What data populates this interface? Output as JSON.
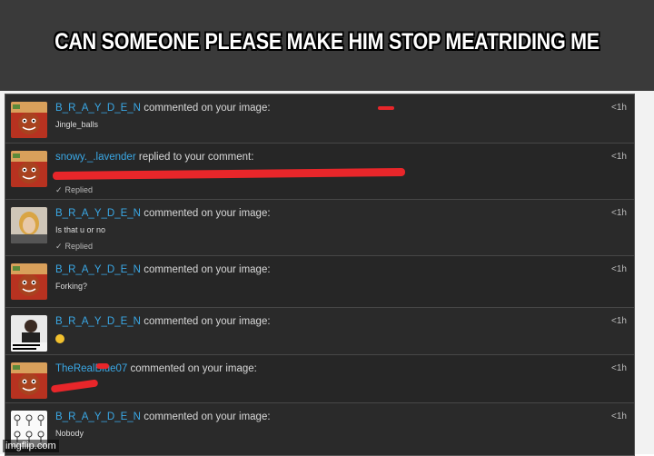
{
  "caption": "CAN SOMEONE PLEASE MAKE HIM STOP MEATRIDING ME",
  "watermark": "imgflip.com",
  "notifications": [
    {
      "user": "B_R_A_Y_D_E_N",
      "action": "commented on your image:",
      "time": "<1h",
      "text": "Jingle_balls",
      "sub": "",
      "avatar": "gingerbread-icon"
    },
    {
      "user": "snowy._.lavender",
      "action": "replied to your comment:",
      "time": "<1h",
      "text": "",
      "sub": "Replied",
      "avatar": "gingerbread-icon"
    },
    {
      "user": "B_R_A_Y_D_E_N",
      "action": "commented on your image:",
      "time": "<1h",
      "text": "Is that u or no",
      "sub": "Replied",
      "avatar": "photo-thumbnail-icon"
    },
    {
      "user": "B_R_A_Y_D_E_N",
      "action": "commented on your image:",
      "time": "<1h",
      "text": "Forking?",
      "sub": "",
      "avatar": "gingerbread-icon"
    },
    {
      "user": "B_R_A_Y_D_E_N",
      "action": "commented on your image:",
      "time": "<1h",
      "text": "",
      "sub": "",
      "avatar": "photo-thumbnail-icon"
    },
    {
      "user": "TheRealBlue07",
      "action": "commented on your image:",
      "time": "<1h",
      "text": "",
      "sub": "",
      "avatar": "gingerbread-icon"
    },
    {
      "user": "B_R_A_Y_D_E_N",
      "action": "commented on your image:",
      "time": "<1h",
      "text": "Nobody",
      "sub": "",
      "avatar": "comic-thumbnail-icon"
    }
  ],
  "colors": {
    "username": "#3aa8e6",
    "panel": "#2a2a2a",
    "scribble": "#e8262a"
  }
}
